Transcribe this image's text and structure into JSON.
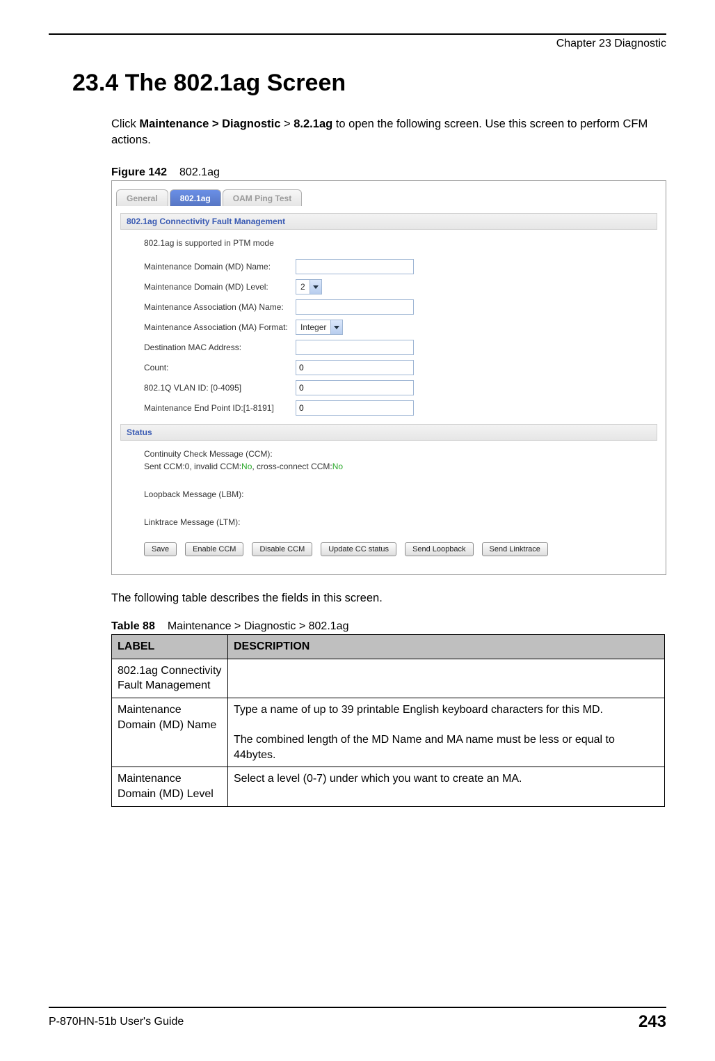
{
  "header": {
    "chapter": "Chapter 23 Diagnostic"
  },
  "section": {
    "title": "23.4  The 802.1ag Screen"
  },
  "intro": {
    "pre": "Click ",
    "path1": "Maintenance > Diagnostic",
    "mid": " > ",
    "path2": "8.2.1ag",
    "post": " to open the following screen. Use this screen to perform CFM actions."
  },
  "figure": {
    "label": "Figure 142",
    "caption": "802.1ag"
  },
  "shot": {
    "tabs": {
      "general": "General",
      "ag": "802.1ag",
      "oam": "OAM Ping Test"
    },
    "sect1": "802.1ag Connectivity Fault Management",
    "note": "802.1ag is supported in PTM mode",
    "fields": {
      "md_name": {
        "label": "Maintenance Domain (MD) Name:",
        "value": ""
      },
      "md_level": {
        "label": "Maintenance Domain (MD) Level:",
        "value": "2"
      },
      "ma_name": {
        "label": "Maintenance Association (MA) Name:",
        "value": ""
      },
      "ma_format": {
        "label": "Maintenance Association (MA) Format:",
        "value": "Integer"
      },
      "dest_mac": {
        "label": "Destination MAC Address:",
        "value": ""
      },
      "count": {
        "label": "Count:",
        "value": "0"
      },
      "vlan": {
        "label": "802.1Q VLAN ID: [0-4095]",
        "value": "0"
      },
      "mep": {
        "label": "Maintenance End Point ID:[1-8191]",
        "value": "0"
      }
    },
    "sect2": "Status",
    "status": {
      "ccm_label": "Continuity Check Message (CCM):",
      "line2_a": "Sent CCM:0, invalid CCM:",
      "no1": "No",
      "line2_b": ", cross-connect CCM:",
      "no2": "No",
      "lbm": "Loopback Message (LBM):",
      "ltm": "Linktrace Message (LTM):"
    },
    "buttons": {
      "save": "Save",
      "enable": "Enable CCM",
      "disable": "Disable CCM",
      "update": "Update CC status",
      "loopback": "Send Loopback",
      "linktrace": "Send Linktrace"
    }
  },
  "after_figure": "The following table describes the fields in this screen.",
  "table": {
    "label": "Table 88",
    "caption": "Maintenance > Diagnostic > 802.1ag",
    "head": {
      "c1": "LABEL",
      "c2": "DESCRIPTION"
    },
    "rows": [
      {
        "c1": "802.1ag Connectivity Fault Management",
        "c2": ""
      },
      {
        "c1": "Maintenance Domain (MD) Name",
        "c2": "Type a name of up to 39 printable English keyboard characters for this MD.\n\nThe combined length of the MD Name and MA name must be less or equal to 44bytes."
      },
      {
        "c1": "Maintenance Domain (MD) Level",
        "c2": "Select a level (0-7) under which you want to create an MA."
      }
    ]
  },
  "footer": {
    "guide": "P-870HN-51b User's Guide",
    "page": "243"
  }
}
